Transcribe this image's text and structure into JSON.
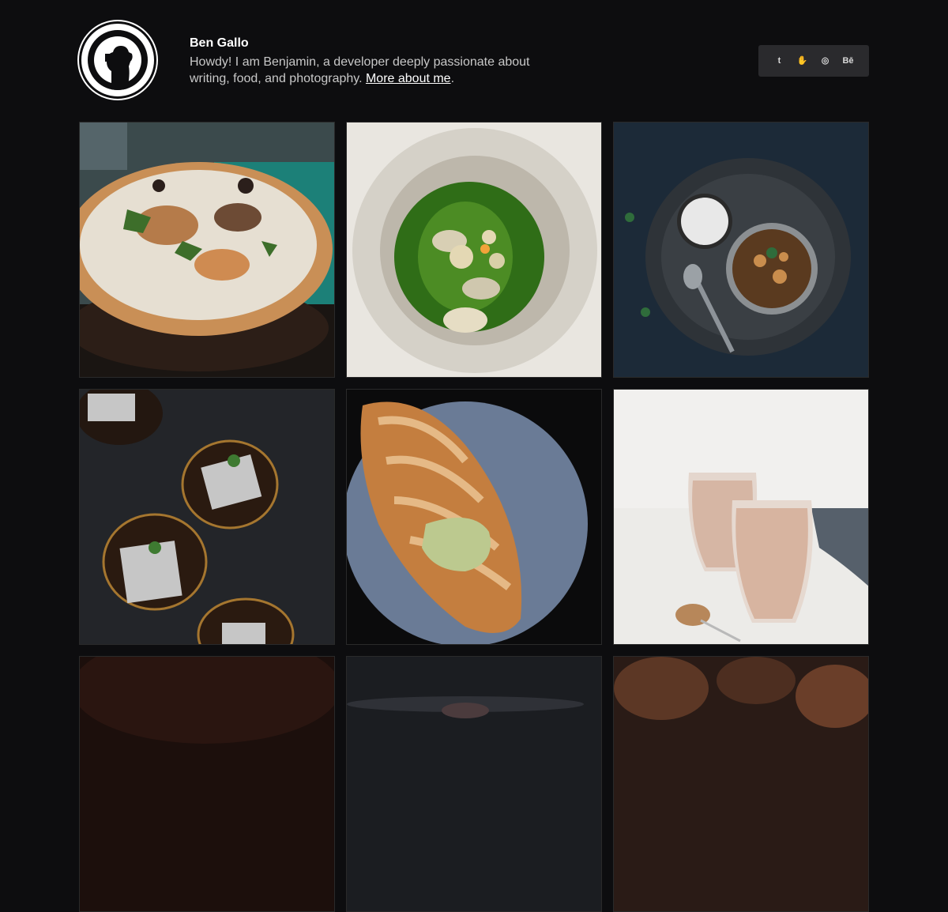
{
  "profile": {
    "name": "Ben Gallo",
    "description_prefix": "Howdy! I am Benjamin, a developer deeply passionate about writing, food, and photography. ",
    "more_link": "More about me",
    "description_suffix": "."
  },
  "social": [
    {
      "icon": "tumblr-icon",
      "glyph": "t"
    },
    {
      "icon": "hand-icon",
      "glyph": "✋"
    },
    {
      "icon": "instagram-icon",
      "glyph": "◎"
    },
    {
      "icon": "behance-icon",
      "glyph": "Bē"
    }
  ],
  "photos": [
    {
      "name": "photo-pizza"
    },
    {
      "name": "photo-green-bowl"
    },
    {
      "name": "photo-curry-platter"
    },
    {
      "name": "photo-brownies"
    },
    {
      "name": "photo-croissant"
    },
    {
      "name": "photo-smoothies"
    },
    {
      "name": "photo-dark-dish-1"
    },
    {
      "name": "photo-dark-dish-2"
    },
    {
      "name": "photo-dark-dish-3"
    }
  ]
}
